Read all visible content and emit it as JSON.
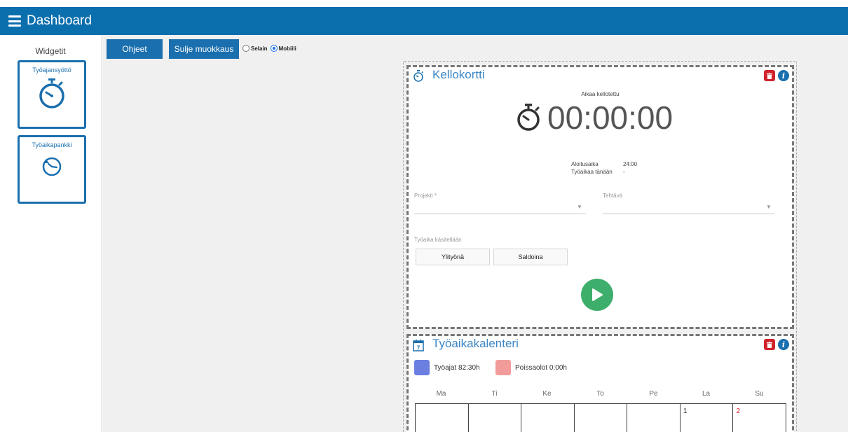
{
  "header": {
    "title": "Dashboard"
  },
  "sidebar": {
    "heading": "Widgetit",
    "widgets": [
      {
        "label": "Työajansyöttö",
        "icon": "stopwatch-icon"
      },
      {
        "label": "Työaikapankki",
        "icon": "clock-history-icon"
      }
    ]
  },
  "toolbar": {
    "help_label": "Ohjeet",
    "close_edit_label": "Sulje muokkaus",
    "view_options": [
      {
        "label": "Selain",
        "selected": false
      },
      {
        "label": "Mobiili",
        "selected": true
      }
    ]
  },
  "clock_card": {
    "title": "Kellokortti",
    "status": "Aikaa kellotettu",
    "timer": "00:00:00",
    "start_label": "Aloitusaika",
    "start_value": "24:00",
    "today_label": "Työaikaa tänään",
    "today_value": "-",
    "project_label": "Projekti *",
    "task_label": "Tehtävä",
    "handling_label": "Työaika käsitellään",
    "overtime_label": "Ylityönä",
    "balance_label": "Saldoina"
  },
  "calendar": {
    "title": "Työaikakalenteri",
    "icon_day": "7",
    "legend": [
      {
        "label": "Työajat 82:30h",
        "color": "#6b7fe0"
      },
      {
        "label": "Poissaolot 0:00h",
        "color": "#f29b9b"
      }
    ],
    "weekdays": [
      "Ma",
      "Ti",
      "Ke",
      "To",
      "Pe",
      "La",
      "Su"
    ],
    "first_week": [
      "",
      "",
      "",
      "",
      "",
      "1",
      "2"
    ]
  },
  "colors": {
    "header_bg": "#0b6fae",
    "accent": "#1a6fae",
    "delete": "#d0232b",
    "play": "#3eae6c"
  }
}
